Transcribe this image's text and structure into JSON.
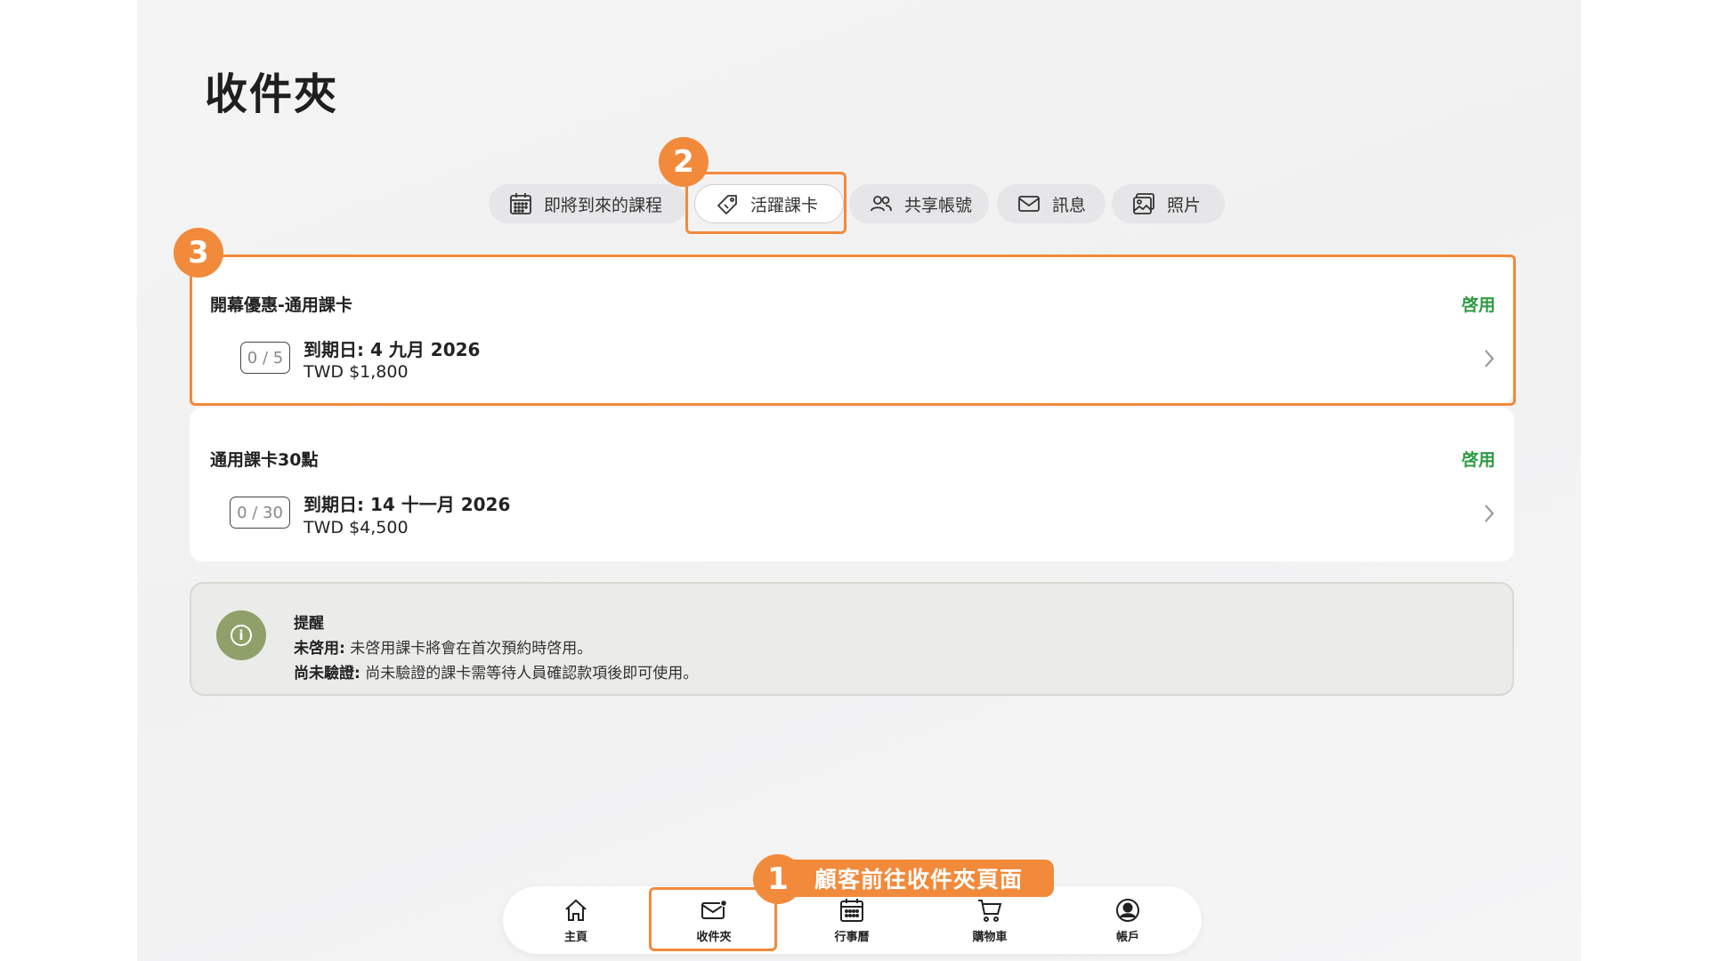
{
  "page": {
    "title": "收件夾"
  },
  "tabs": [
    {
      "label": "即將到來的課程",
      "icon": "calendar-icon"
    },
    {
      "label": "活躍課卡",
      "icon": "tag-icon",
      "active": true
    },
    {
      "label": "共享帳號",
      "icon": "users-icon"
    },
    {
      "label": "訊息",
      "icon": "mail-icon"
    },
    {
      "label": "照片",
      "icon": "photo-icon"
    }
  ],
  "cards": [
    {
      "title": "開幕優惠-通用課卡",
      "status": "啓用",
      "counter": "0 / 5",
      "expiry": "到期日: 4 九月 2026",
      "price": "TWD $1,800"
    },
    {
      "title": "通用課卡30點",
      "status": "啓用",
      "counter": "0 / 30",
      "expiry": "到期日: 14 十一月 2026",
      "price": "TWD $4,500"
    }
  ],
  "notice": {
    "heading": "提醒",
    "line1_label": "未啓用:",
    "line1_text": " 未啓用課卡將會在首次預約時啓用。",
    "line2_label": "尚未驗證:",
    "line2_text": " 尚未驗證的課卡需等待人員確認款項後即可使用。"
  },
  "bottom_nav": [
    {
      "label": "主頁",
      "icon": "home-icon"
    },
    {
      "label": "收件夾",
      "icon": "inbox-icon"
    },
    {
      "label": "行事曆",
      "icon": "calendar-icon"
    },
    {
      "label": "購物車",
      "icon": "cart-icon"
    },
    {
      "label": "帳戶",
      "icon": "account-icon"
    }
  ],
  "annotations": {
    "badge1": "1",
    "badge2": "2",
    "badge3": "3",
    "callout": "顧客前往收件夾頁面"
  },
  "colors": {
    "accent": "#f28a3c",
    "active_status": "#2e9a43",
    "info": "#8fa06a"
  }
}
